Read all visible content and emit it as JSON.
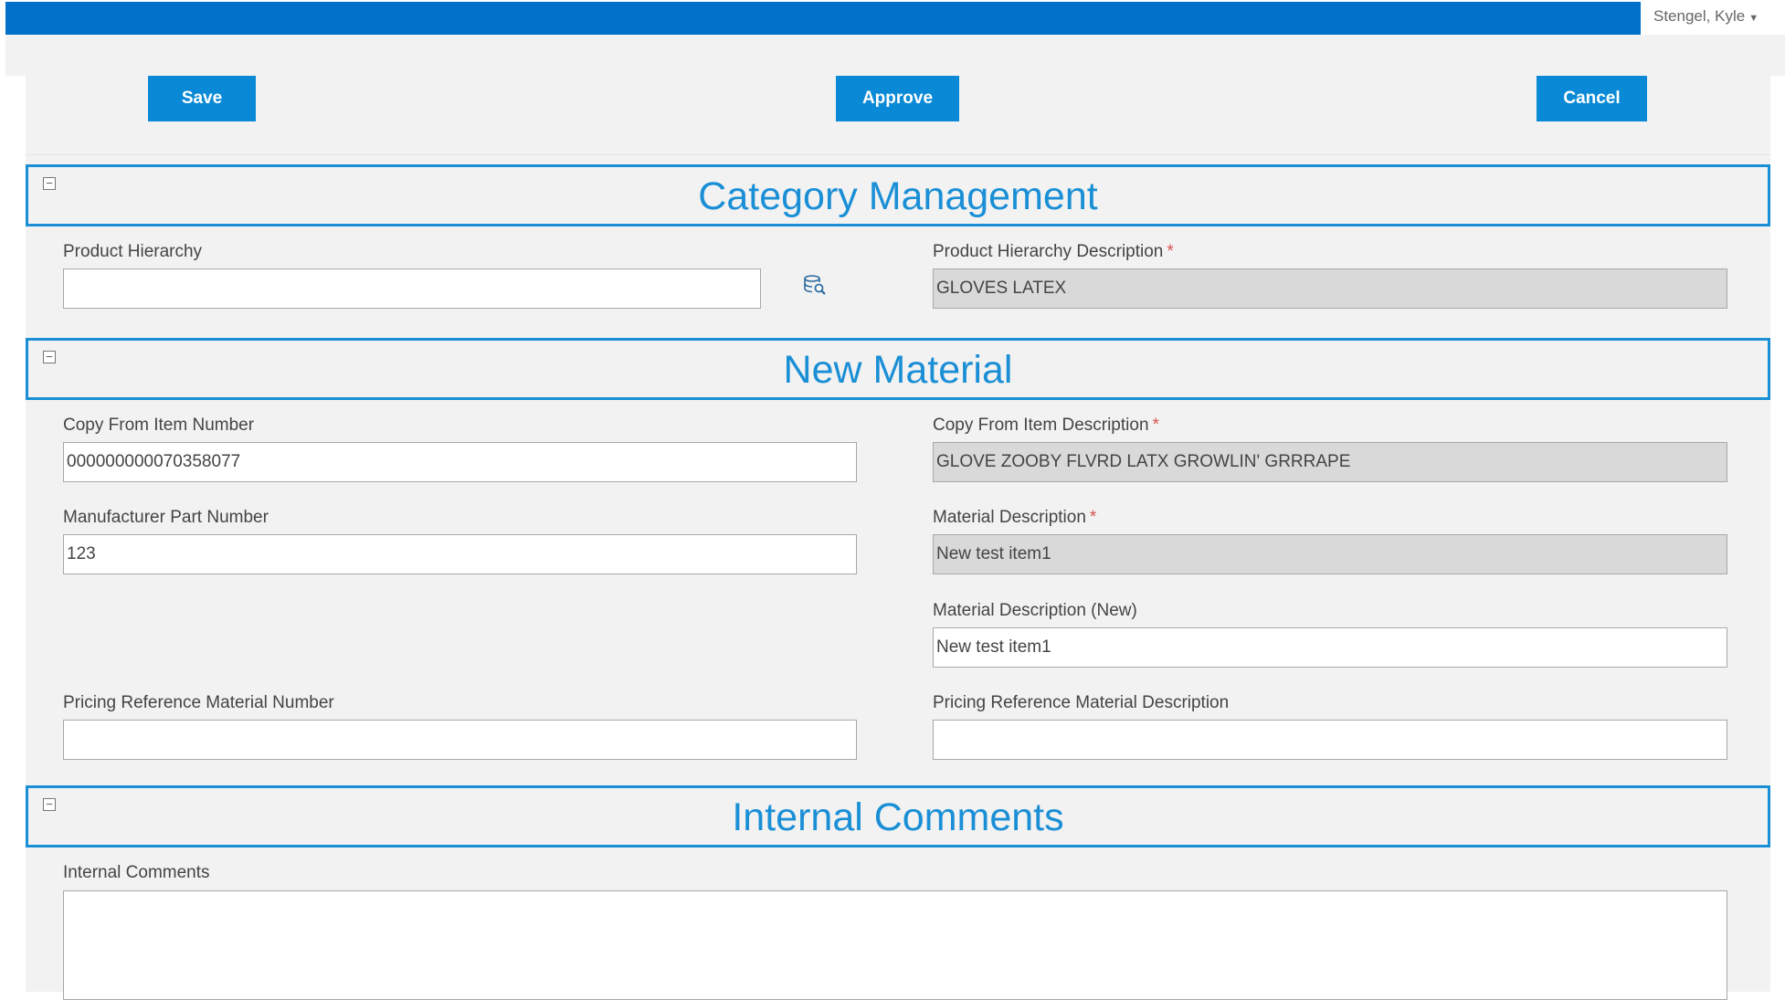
{
  "header": {
    "user_name": "Stengel, Kyle"
  },
  "toolbar": {
    "save_label": "Save",
    "approve_label": "Approve",
    "cancel_label": "Cancel"
  },
  "category_management": {
    "title": "Category Management",
    "product_hierarchy_label": "Product Hierarchy",
    "product_hierarchy_value": "",
    "product_hierarchy_description_label": "Product Hierarchy Description",
    "product_hierarchy_description_value": "GLOVES LATEX"
  },
  "new_material": {
    "title": "New Material",
    "copy_from_item_number_label": "Copy From Item Number",
    "copy_from_item_number_value": "000000000070358077",
    "copy_from_item_description_label": "Copy From Item Description",
    "copy_from_item_description_value": "GLOVE ZOOBY FLVRD LATX GROWLIN' GRRRAPE",
    "manufacturer_part_number_label": "Manufacturer Part Number",
    "manufacturer_part_number_value": "123",
    "material_description_label": "Material Description",
    "material_description_value": "New test item1",
    "material_description_new_label": "Material Description (New)",
    "material_description_new_value": "New test item1",
    "pricing_reference_material_number_label": "Pricing Reference Material Number",
    "pricing_reference_material_number_value": "",
    "pricing_reference_material_description_label": "Pricing Reference Material Description",
    "pricing_reference_material_description_value": ""
  },
  "internal_comments": {
    "title": "Internal Comments",
    "comments_label": "Internal Comments"
  },
  "required_marker": "*",
  "collapse_glyph": "−",
  "colors": {
    "topbar": "#0070c8",
    "accent": "#1a8fd6",
    "button": "#0a8ad6",
    "required": "#d9534f"
  }
}
